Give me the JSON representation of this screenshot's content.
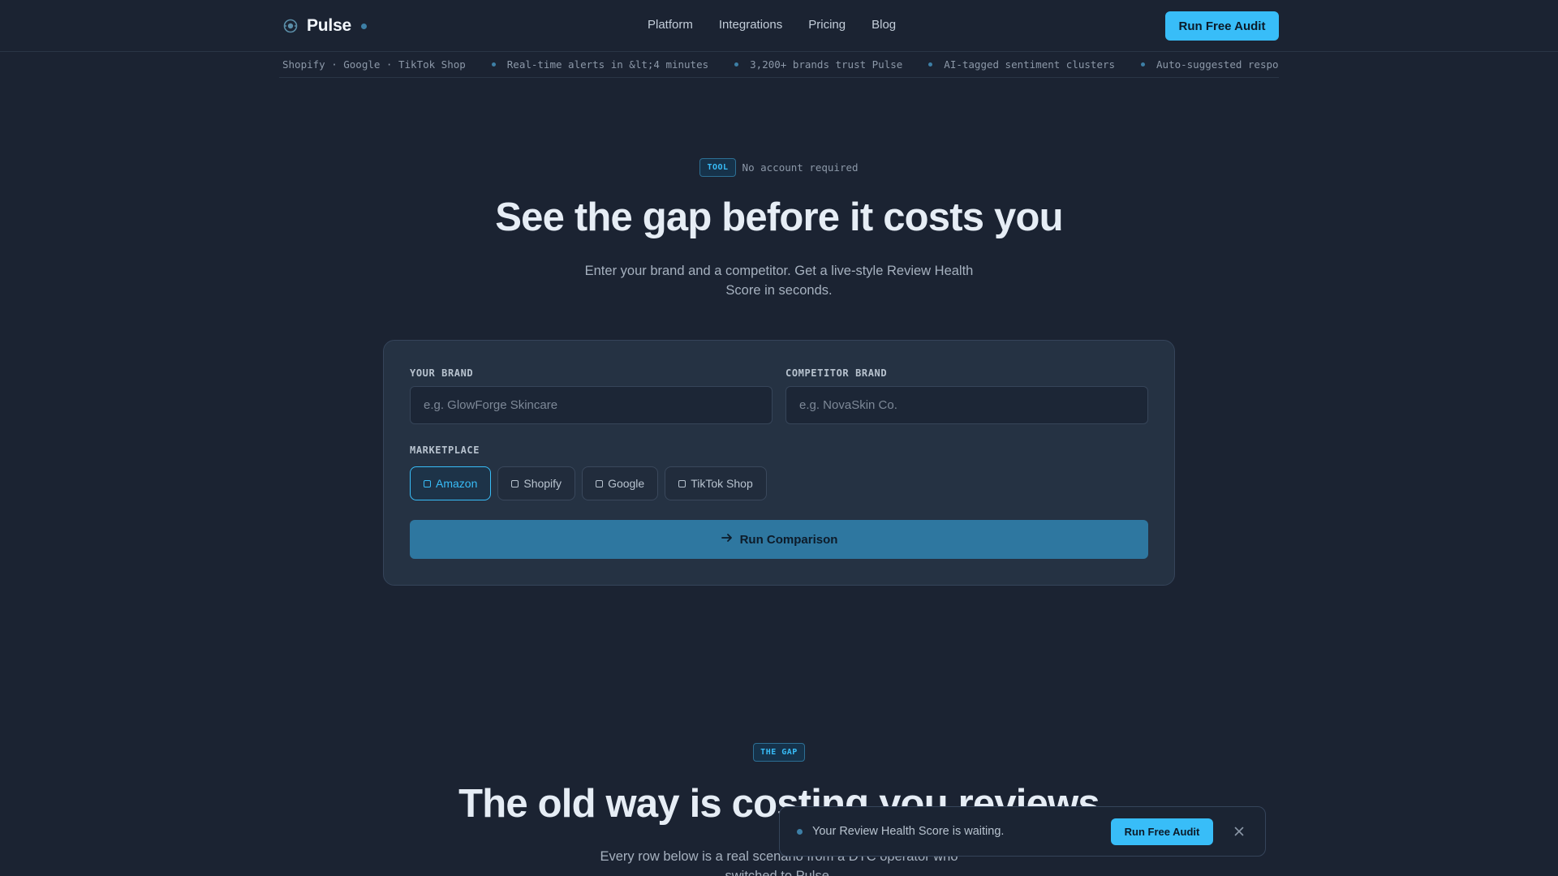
{
  "header": {
    "brand": "Pulse",
    "nav": [
      "Platform",
      "Integrations",
      "Pricing",
      "Blog"
    ],
    "cta": "Run Free Audit"
  },
  "ticker": {
    "lead": "Shopify · Google · TikTok Shop",
    "items": [
      "Real-time alerts in &lt;4 minutes",
      "3,200+ brands trust Pulse",
      "AI-tagged sentiment clusters",
      "Auto-suggested response tem"
    ]
  },
  "hero": {
    "tag": "TOOL",
    "tag_note": "No account required",
    "title": "See the gap before it costs you",
    "subtitle": "Enter your brand and a competitor. Get a live-style Review Health Score in seconds."
  },
  "form": {
    "your_brand_label": "YOUR BRAND",
    "your_brand_placeholder": "e.g. GlowForge Skincare",
    "your_brand_value": "",
    "competitor_label": "COMPETITOR BRAND",
    "competitor_placeholder": "e.g. NovaSkin Co.",
    "competitor_value": "",
    "marketplace_label": "MARKETPLACE",
    "marketplaces": [
      {
        "label": "Amazon",
        "selected": true
      },
      {
        "label": "Shopify",
        "selected": false
      },
      {
        "label": "Google",
        "selected": false
      },
      {
        "label": "TikTok Shop",
        "selected": false
      }
    ],
    "submit": "Run Comparison"
  },
  "gap_section": {
    "tag": "THE GAP",
    "title": "The old way is costing you reviews",
    "subtitle": "Every row below is a real scenario from a DTC operator who switched to Pulse."
  },
  "toast": {
    "message": "Your Review Health Score is waiting.",
    "cta": "Run Free Audit"
  },
  "colors": {
    "background": "#1b2332",
    "accent": "#38bdf8",
    "button_primary_dim": "#2e77a0",
    "card": "#253243"
  }
}
